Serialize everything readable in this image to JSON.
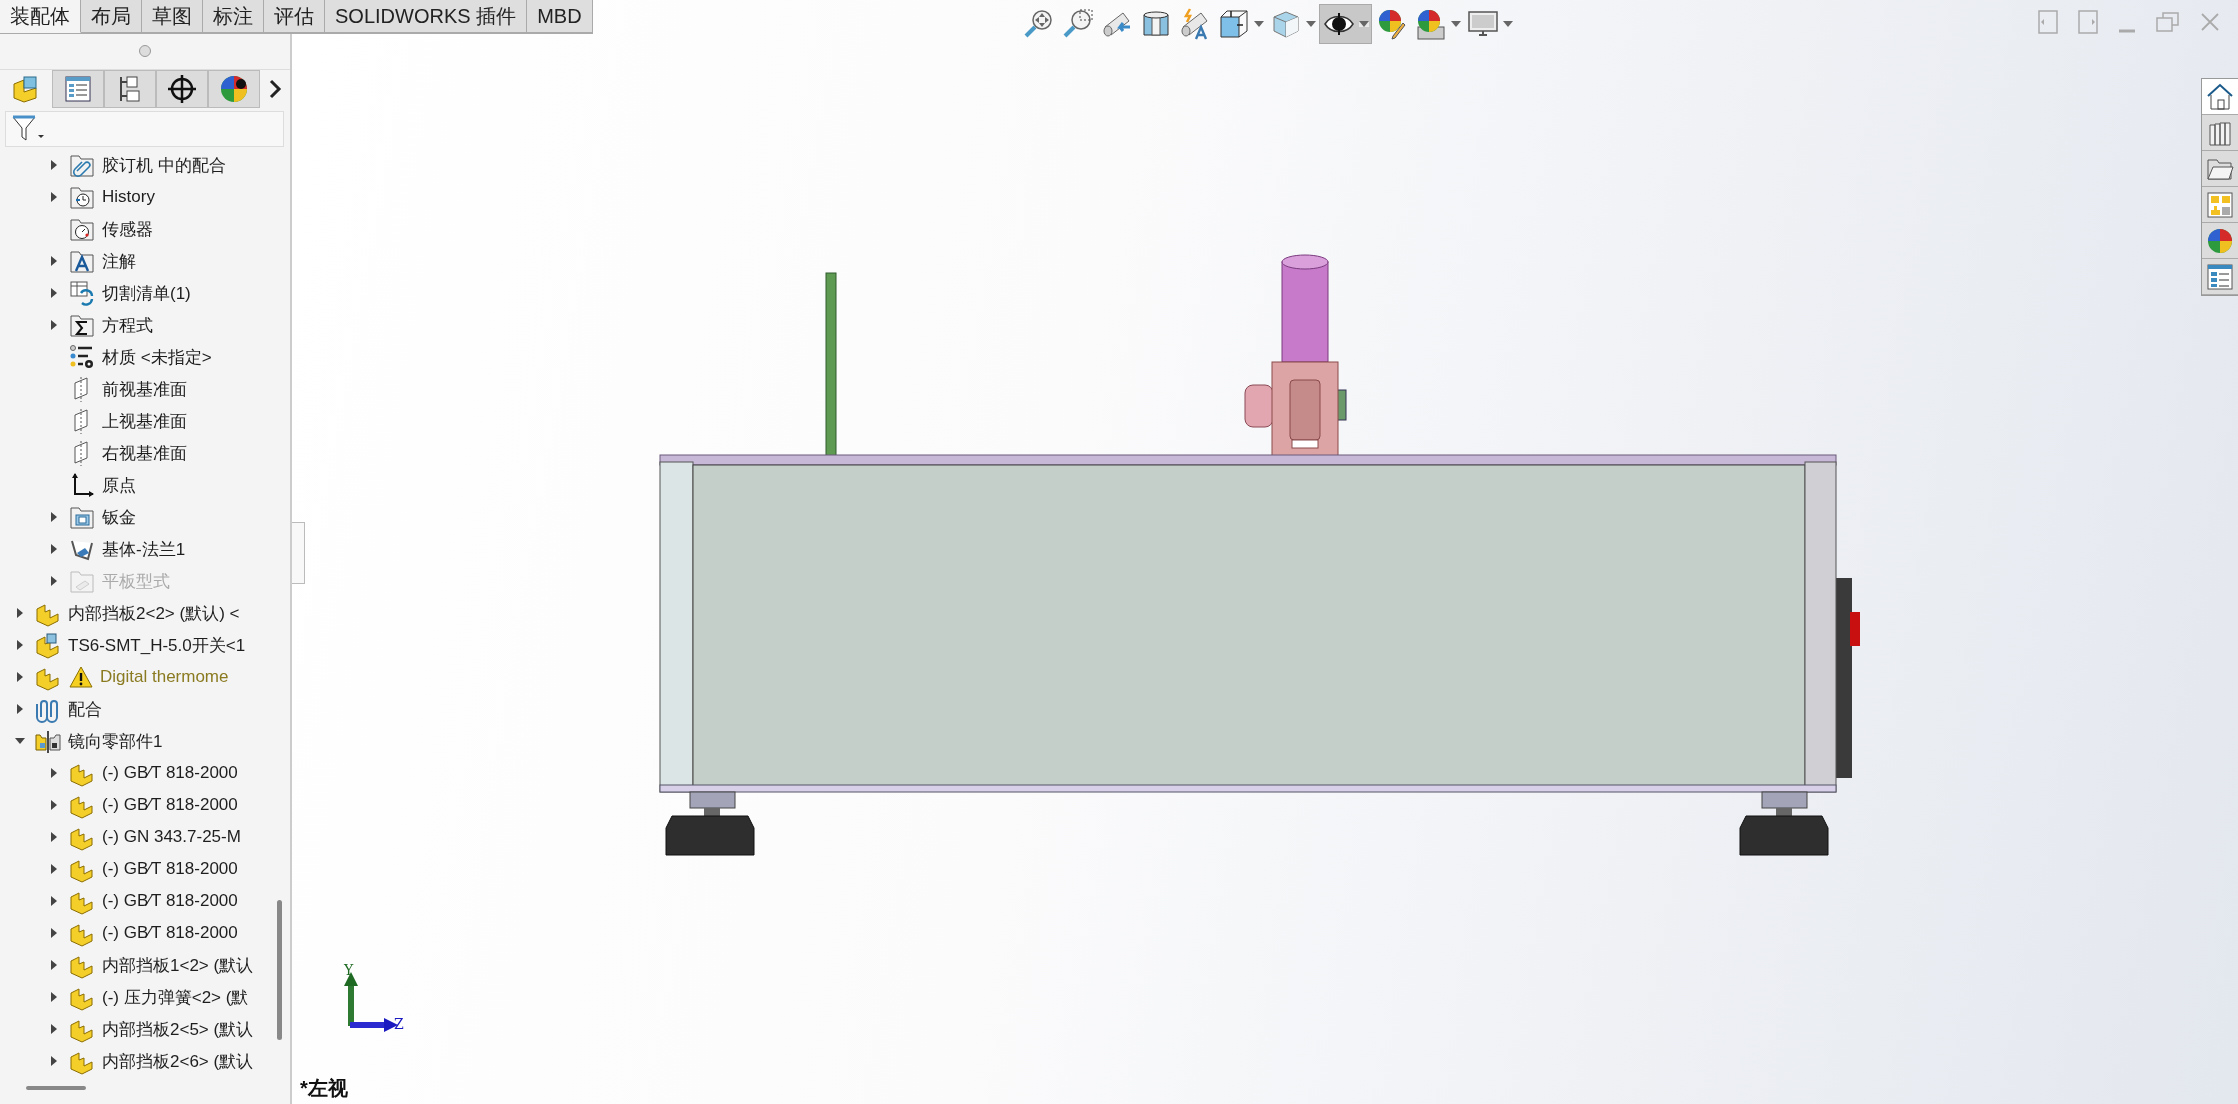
{
  "command_tabs": [
    {
      "label": "装配体",
      "selected": true
    },
    {
      "label": "布局",
      "selected": false
    },
    {
      "label": "草图",
      "selected": false
    },
    {
      "label": "标注",
      "selected": false
    },
    {
      "label": "评估",
      "selected": false
    },
    {
      "label": "SOLIDWORKS 插件",
      "selected": false
    },
    {
      "label": "MBD",
      "selected": false
    }
  ],
  "feature_manager_tabs": [
    {
      "kind": "feature-tree",
      "selected": true
    },
    {
      "kind": "property",
      "selected": false
    },
    {
      "kind": "config",
      "selected": false
    },
    {
      "kind": "dimxpert",
      "selected": false
    },
    {
      "kind": "display",
      "selected": false
    }
  ],
  "tree": {
    "continued_children": [
      {
        "label": "胶订机 中的配合",
        "kind": "folder-mates",
        "expanded": false
      },
      {
        "label": "History",
        "kind": "folder-history",
        "expanded": false
      },
      {
        "label": "传感器",
        "kind": "folder-sensor"
      },
      {
        "label": "注解",
        "kind": "folder-annotation",
        "expanded": false
      },
      {
        "label": "切割清单(1)",
        "kind": "cutlist",
        "expanded": false
      },
      {
        "label": "方程式",
        "kind": "folder-equation",
        "expanded": false
      },
      {
        "label": "材质 <未指定>",
        "kind": "material"
      },
      {
        "label": "前视基准面",
        "kind": "plane"
      },
      {
        "label": "上视基准面",
        "kind": "plane"
      },
      {
        "label": "右视基准面",
        "kind": "plane"
      },
      {
        "label": "原点",
        "kind": "origin"
      },
      {
        "label": "钣金",
        "kind": "folder-sheetmetal",
        "expanded": false
      },
      {
        "label": "基体-法兰1",
        "kind": "flange",
        "expanded": false
      },
      {
        "label": "平板型式",
        "kind": "folder-flat",
        "expanded": false,
        "disabled": true
      }
    ],
    "items": [
      {
        "label": "内部挡板2<2> (默认) <",
        "kind": "part",
        "expanded": false
      },
      {
        "label": "TS6-SMT_H-5.0开关<1",
        "kind": "part-blue",
        "expanded": false
      },
      {
        "label": "Digital thermome",
        "kind": "part",
        "expanded": false,
        "warning": true
      },
      {
        "label": "配合",
        "kind": "mates",
        "expanded": false
      },
      {
        "label": "镜向零部件1",
        "kind": "mirror",
        "expanded": true,
        "children": [
          {
            "label": "(-) GB⁄T 818-2000",
            "kind": "part",
            "expanded": false
          },
          {
            "label": "(-) GB⁄T 818-2000",
            "kind": "part",
            "expanded": false
          },
          {
            "label": "(-) GN 343.7-25-M",
            "kind": "part",
            "expanded": false
          },
          {
            "label": "(-) GB⁄T 818-2000",
            "kind": "part",
            "expanded": false
          },
          {
            "label": "(-) GB⁄T 818-2000",
            "kind": "part",
            "expanded": false
          },
          {
            "label": "(-) GB⁄T 818-2000",
            "kind": "part",
            "expanded": false
          },
          {
            "label": "内部挡板1<2> (默认",
            "kind": "part",
            "expanded": false
          },
          {
            "label": "(-) 压力弹簧<2> (默",
            "kind": "part",
            "expanded": false
          },
          {
            "label": "内部挡板2<5> (默认",
            "kind": "part",
            "expanded": false
          },
          {
            "label": "内部挡板2<6> (默认",
            "kind": "part",
            "expanded": false
          }
        ]
      }
    ]
  },
  "heads_up_toolbar": [
    {
      "kind": "zoom-fit",
      "dropdown": false,
      "selected": false
    },
    {
      "kind": "zoom-area",
      "dropdown": false,
      "selected": false
    },
    {
      "kind": "previous-view",
      "dropdown": false,
      "selected": false
    },
    {
      "kind": "section-view",
      "dropdown": false,
      "selected": false
    },
    {
      "kind": "dynamic-annotation",
      "dropdown": false,
      "selected": false
    },
    {
      "kind": "view-orientation",
      "dropdown": true,
      "selected": false
    },
    {
      "kind": "display-style",
      "dropdown": true,
      "selected": false
    },
    {
      "kind": "hide-show",
      "dropdown": true,
      "selected": true
    },
    {
      "kind": "edit-appearance",
      "dropdown": false,
      "selected": false
    },
    {
      "kind": "apply-scene",
      "dropdown": true,
      "selected": false
    },
    {
      "kind": "view-settings",
      "dropdown": true,
      "selected": false
    }
  ],
  "task_pane": [
    {
      "kind": "home",
      "selected": true
    },
    {
      "kind": "library",
      "selected": false
    },
    {
      "kind": "explorer",
      "selected": false
    },
    {
      "kind": "palette",
      "selected": false
    },
    {
      "kind": "appearance",
      "selected": false
    },
    {
      "kind": "properties",
      "selected": false
    }
  ],
  "triad": {
    "y_label": "Y",
    "z_label": "Z"
  },
  "view_label": "*左视"
}
